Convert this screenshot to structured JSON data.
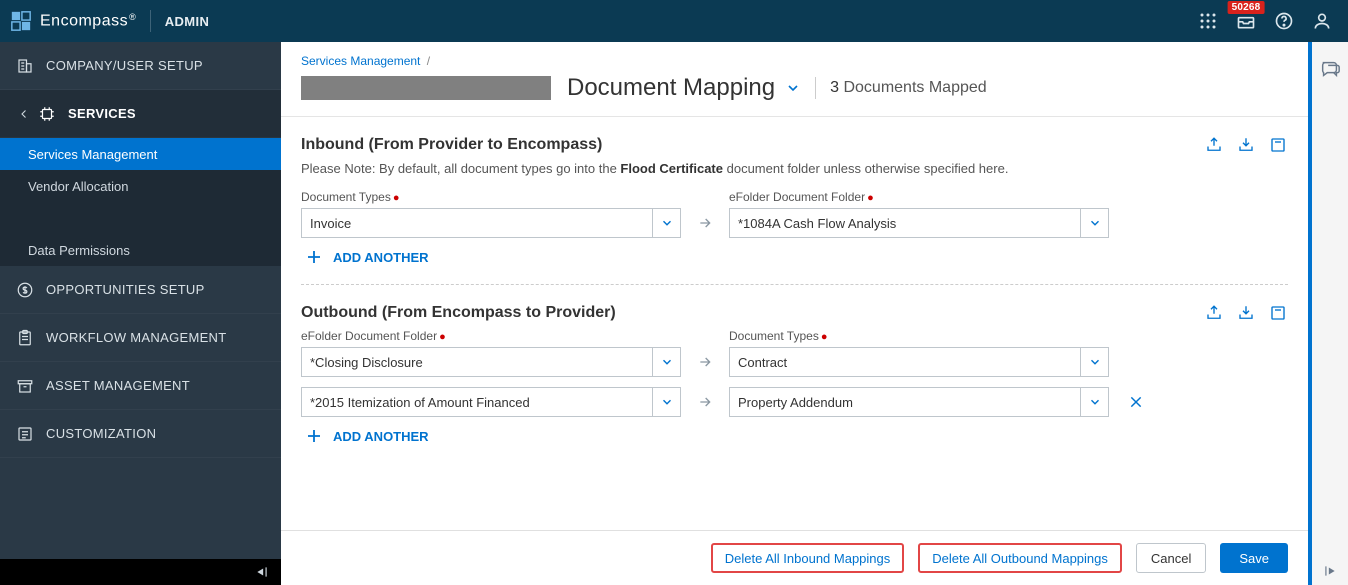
{
  "header": {
    "brand": "Encompass",
    "mode": "ADMIN",
    "notification_count": "50268"
  },
  "sidebar": {
    "items": [
      {
        "label": "COMPANY/USER SETUP"
      },
      {
        "label": "SERVICES"
      },
      {
        "label": "OPPORTUNITIES SETUP"
      },
      {
        "label": "WORKFLOW MANAGEMENT"
      },
      {
        "label": "ASSET MANAGEMENT"
      },
      {
        "label": "CUSTOMIZATION"
      }
    ],
    "services_sub": [
      {
        "label": "Services Management"
      },
      {
        "label": "Vendor Allocation"
      },
      {
        "label": ""
      },
      {
        "label": "Data Permissions"
      }
    ]
  },
  "crumbs": {
    "root": "Services Management",
    "sep": "/"
  },
  "title": {
    "text": "Document Mapping",
    "count_num": "3",
    "count_label": " Documents Mapped"
  },
  "inbound": {
    "title": "Inbound (From Provider to Encompass)",
    "note_pre": "Please Note: By default, all document types go into the ",
    "note_bold": "Flood Certificate",
    "note_post": " document folder unless otherwise specified here.",
    "left_label": "Document Types",
    "right_label": "eFolder Document Folder",
    "rows": [
      {
        "left": "Invoice",
        "right": "*1084A Cash Flow Analysis"
      }
    ],
    "add_label": "ADD ANOTHER"
  },
  "outbound": {
    "title": "Outbound (From Encompass to Provider)",
    "left_label": "eFolder Document Folder",
    "right_label": "Document Types",
    "rows": [
      {
        "left": "*Closing Disclosure",
        "right": "Contract"
      },
      {
        "left": "*2015 Itemization of Amount Financed",
        "right": "Property Addendum"
      }
    ],
    "add_label": "ADD ANOTHER"
  },
  "footer": {
    "delete_inbound": "Delete All Inbound Mappings",
    "delete_outbound": "Delete All Outbound Mappings",
    "cancel": "Cancel",
    "save": "Save"
  }
}
